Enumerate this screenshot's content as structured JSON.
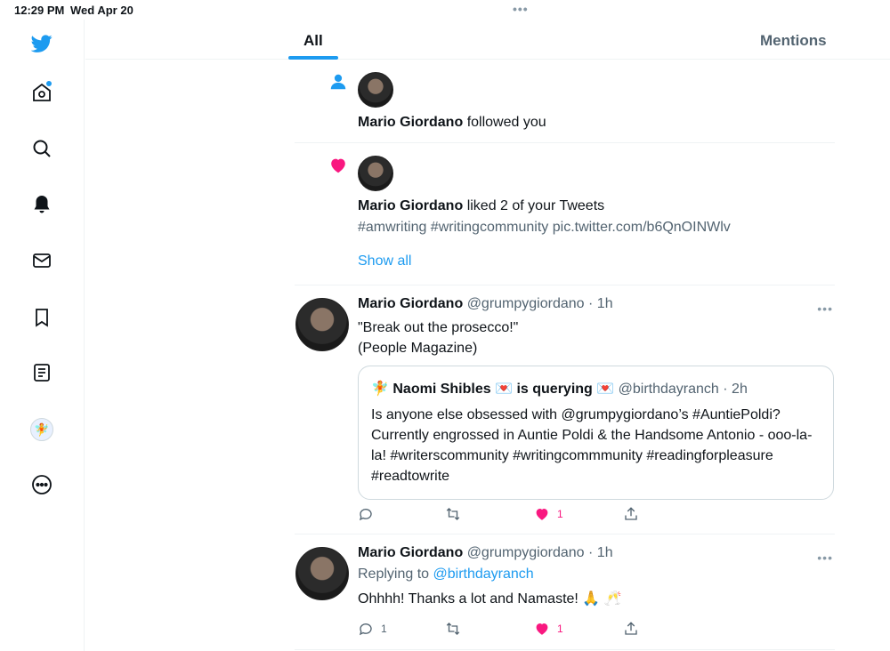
{
  "status": {
    "time": "12:29 PM",
    "date": "Wed Apr 20",
    "dots": "•••"
  },
  "tabs": {
    "all": "All",
    "mentions": "Mentions"
  },
  "notifications": {
    "follow": {
      "name": "Mario Giordano",
      "action": "followed you"
    },
    "likes": {
      "name": "Mario Giordano",
      "action": "liked 2 of your Tweets",
      "preview": "#amwriting #writingcommunity pic.twitter.com/b6QnOINWlv",
      "show_all": "Show all"
    }
  },
  "tweets": [
    {
      "name": "Mario Giordano",
      "handle": "@grumpygiordano",
      "time": "· 1h",
      "line1": "\"Break out the prosecco!\"",
      "line2": "(People Magazine)",
      "quote": {
        "emoji": "🧚",
        "name": "Naomi Shibles",
        "heart1": "💌",
        "name_mid": "is querying",
        "heart2": "💌",
        "handle": "@birthdayranch · 2h",
        "text": "Is anyone else obsessed with @grumpygiordano’s #AuntiePoldi? Currently engrossed in Auntie Poldi & the Handsome Antonio - ooo-la-la! #writerscommunity #writingcommmunity #readingforpleasure #readtowrite"
      },
      "reply_count": "",
      "like_count": "1",
      "more": "•••"
    },
    {
      "name": "Mario Giordano",
      "handle": "@grumpygiordano",
      "time": "· 1h",
      "replying_label": "Replying to",
      "replying_to": "@birthdayranch",
      "text": "Ohhhh! Thanks a lot and Namaste! 🙏 🥂",
      "reply_count": "1",
      "like_count": "1",
      "more": "•••"
    }
  ],
  "colors": {
    "accent": "#1d9bf0",
    "like": "#f91880"
  }
}
